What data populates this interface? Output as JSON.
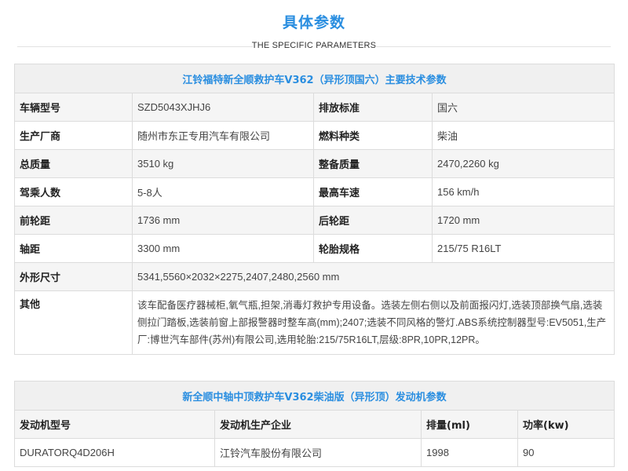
{
  "header": {
    "title": "具体参数",
    "subtitle": "THE SPECIFIC PARAMETERS"
  },
  "params_table": {
    "title": "江铃福特新全顺救护车V362（异形顶国六）主要技术参数",
    "rows": [
      {
        "label1": "车辆型号",
        "value1": "SZD5043XJHJ6",
        "label2": "排放标准",
        "value2": "国六"
      },
      {
        "label1": "生产厂商",
        "value1": "随州市东正专用汽车有限公司",
        "label2": "燃料种类",
        "value2": "柴油"
      },
      {
        "label1": "总质量",
        "value1": "3510 kg",
        "label2": "整备质量",
        "value2": "2470,2260 kg"
      },
      {
        "label1": "驾乘人数",
        "value1": "5-8人",
        "label2": "最高车速",
        "value2": "156 km/h"
      },
      {
        "label1": "前轮距",
        "value1": "1736 mm",
        "label2": "后轮距",
        "value2": "1720 mm"
      },
      {
        "label1": "轴距",
        "value1": "3300 mm",
        "label2": "轮胎规格",
        "value2": "215/75 R16LT"
      }
    ],
    "dimensions": {
      "label": "外形尺寸",
      "value": "5341,5560×2032×2275,2407,2480,2560 mm"
    },
    "other": {
      "label": "其他",
      "value": "该车配备医疗器械柜,氧气瓶,担架,消毒灯救护专用设备。选装左侧右侧以及前面报闪灯,选装顶部换气扇,选装侧拉门踏板,选装前窗上部报警器时整车高(mm);2407;选装不同风格的警灯.ABS系统控制器型号:EV5051,生产厂:博世汽车部件(苏州)有限公司,选用轮胎:215/75R16LT,层级:8PR,10PR,12PR。"
    }
  },
  "engine_table": {
    "title": "新全顺中轴中顶救护车V362柴油版（异形顶）发动机参数",
    "columns": [
      "发动机型号",
      "发动机生产企业",
      "排量(ml)",
      "功率(kw)"
    ],
    "rows": [
      [
        "DURATORQ4D206H",
        "江铃汽车股份有限公司",
        "1998",
        "90"
      ]
    ]
  },
  "colors": {
    "accent": "#2a8ee0",
    "border": "#dcdcdc",
    "stripe": "#f5f5f5",
    "header_bg": "#f0f0f0"
  }
}
